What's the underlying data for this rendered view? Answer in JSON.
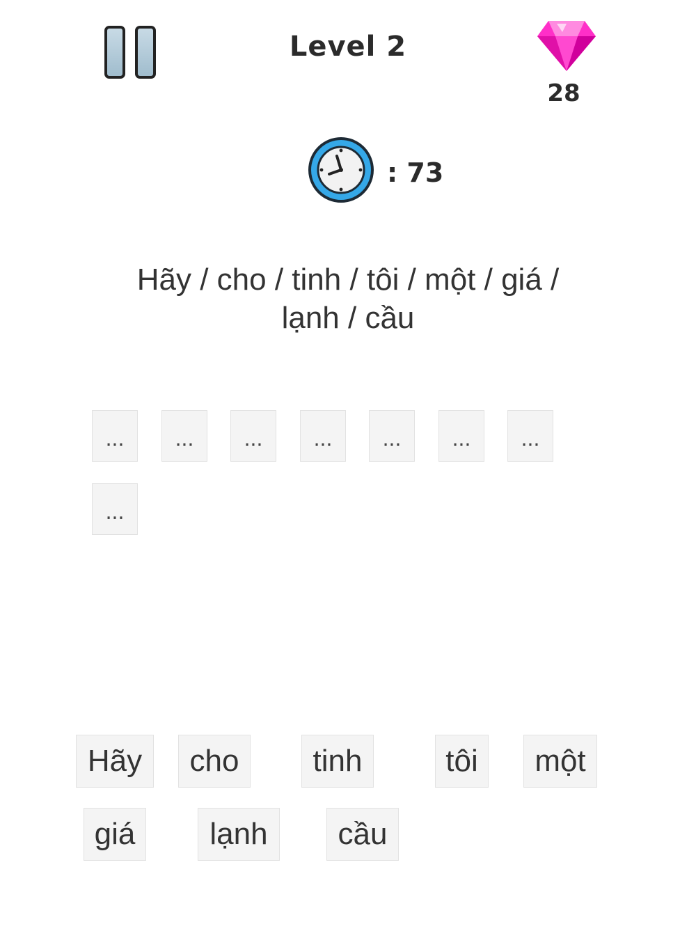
{
  "header": {
    "level_title": "Level 2",
    "gem_count": "28",
    "gem_color": "#ff2fc8"
  },
  "timer": {
    "label": ": 73",
    "ring_color": "#35a8e8"
  },
  "prompt": {
    "line1": "Hãy / cho / tinh / tôi / một / giá /",
    "line2": "lạnh / cầu"
  },
  "slots": [
    "...",
    "...",
    "...",
    "...",
    "...",
    "...",
    "...",
    "..."
  ],
  "words": [
    "Hãy",
    "cho",
    "tinh",
    "tôi",
    "một",
    "giá",
    "lạnh",
    "cầu"
  ]
}
